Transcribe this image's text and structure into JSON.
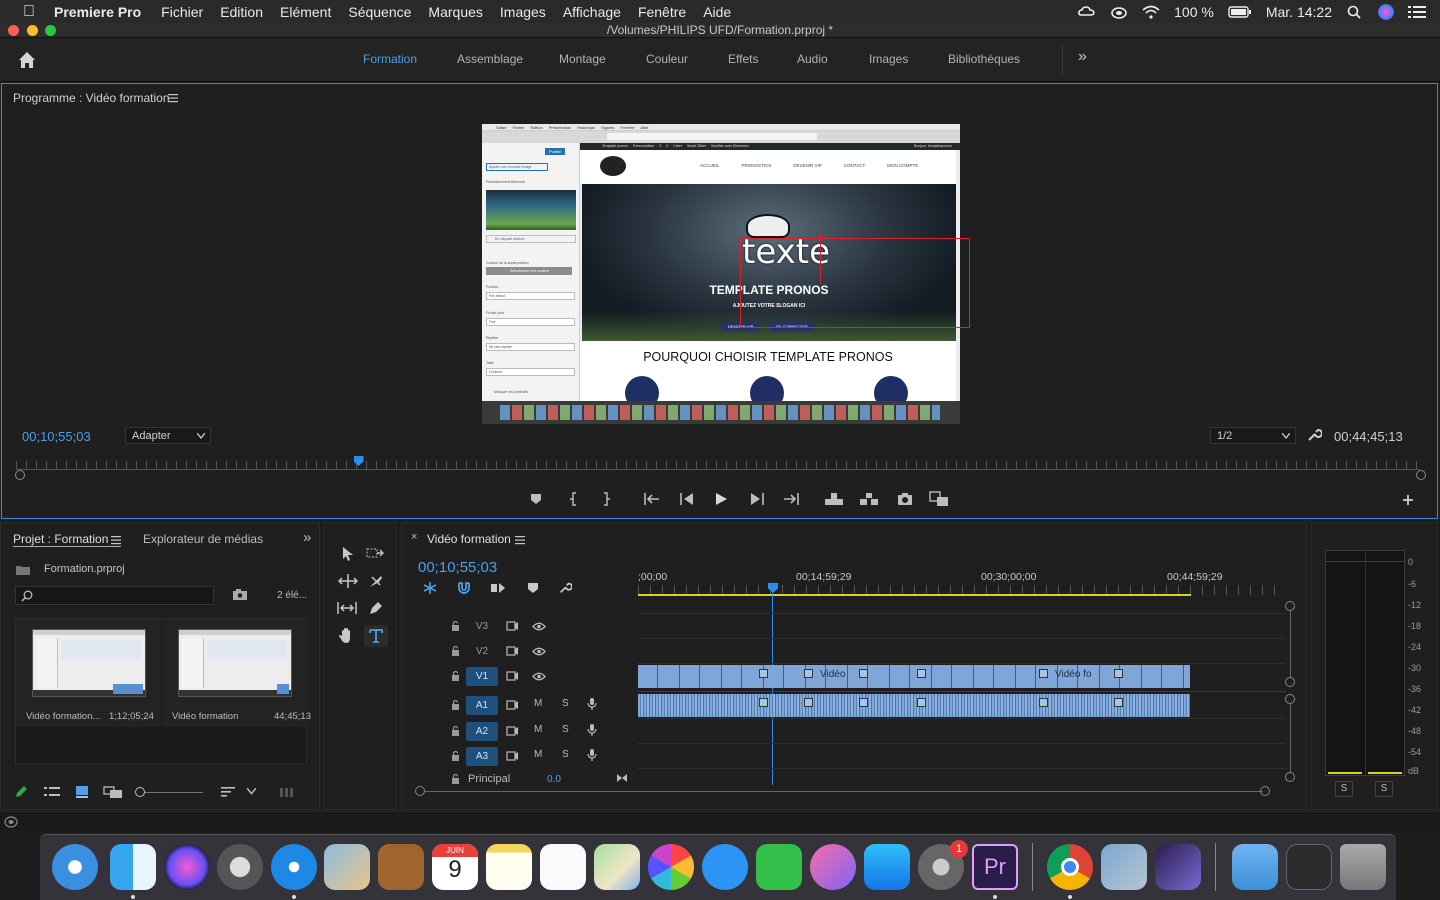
{
  "menubar": {
    "app_name": "Premiere Pro",
    "menus": [
      "Fichier",
      "Edition",
      "Elément",
      "Séquence",
      "Marques",
      "Images",
      "Affichage",
      "Fenêtre",
      "Aide"
    ],
    "battery": "100 %",
    "clock": "Mar. 14:22"
  },
  "window": {
    "title": "/Volumes/PHILIPS UFD/Formation.prproj *"
  },
  "workspaces": {
    "tabs": [
      "Formation",
      "Assemblage",
      "Montage",
      "Couleur",
      "Effets",
      "Audio",
      "Images",
      "Bibliothèques"
    ],
    "active": "Formation",
    "more": "»"
  },
  "program": {
    "title": "Programme : Vidéo formation",
    "timecode": "00;10;55;03",
    "fit": "Adapter",
    "resolution": "1/2",
    "duration": "00;44;45;13",
    "playhead_fraction": 0.244
  },
  "video": {
    "menu": [
      "Safari",
      "Fichier",
      "Édition",
      "Présentation",
      "Historique",
      "Signets",
      "Fenêtre",
      "Aide"
    ],
    "sidebar": {
      "publish": "Publier",
      "add_image": "Ajouter une nouvelle image",
      "prev_label": "Précédemment téléversé",
      "choose": "En cliquant ailleurs",
      "overlay_label": "Couleur de la superposition",
      "overlay_btn": "Sélectionner une couleur",
      "position_label": "Position",
      "position_val": "Par défaut",
      "attach_label": "Fichier joint",
      "attach_val": "Fixé",
      "repeat_label": "Répéter",
      "repeat_val": "Ne pas répéter",
      "size_label": "Taille",
      "size_val": "Contenir",
      "hide": "Masquer les contrôles"
    },
    "nav": [
      "ACCUEIL",
      "PRONOSTICS",
      "DEVENIR VIP",
      "CONTACT",
      "MON COMPTE"
    ],
    "admin_bar": [
      "Template pronos",
      "Personnaliser",
      "2",
      "0",
      "Créer",
      "Smart Slider",
      "Modifier avec Elementor"
    ],
    "admin_right": "Bonjour, templatepronos",
    "hero_overlay_text": "texte",
    "hero_title": "TEMPLATE PRONOS",
    "hero_slogan": "AJOUTEZ VOTRE SLOGAN ICI",
    "btn_vip": "DEVENIR VIP",
    "btn_login": "SE CONNECTER",
    "section_title": "POURQUOI CHOISIR TEMPLATE PRONOS"
  },
  "project": {
    "tab_project": "Projet : Formation",
    "tab_media": "Explorateur de médias",
    "file": "Formation.prproj",
    "count": "2 élé...",
    "items": [
      {
        "name": "Vidéo formation...",
        "duration": "1;12;05;24"
      },
      {
        "name": "Vidéo formation",
        "duration": "44;45;13"
      }
    ]
  },
  "timeline": {
    "title": "Vidéo formation",
    "timecode": "00;10;55;03",
    "ruler": [
      ";00;00",
      "00;14;59;29",
      "00;30;00;00",
      "00;44;59;29"
    ],
    "video_tracks": [
      "V3",
      "V2",
      "V1"
    ],
    "audio_tracks": [
      "A1",
      "A2",
      "A3"
    ],
    "master": "Principal",
    "master_value": "0.0",
    "clip_labels": [
      "Vidéo",
      "Vidéo fo"
    ]
  },
  "meter": {
    "labels": [
      "0",
      "-6",
      "-12",
      "-18",
      "-24",
      "-30",
      "-36",
      "-42",
      "-48",
      "-54",
      "dB"
    ],
    "solo": [
      "S",
      "S"
    ]
  },
  "dock": {
    "calendar_month": "JUIN",
    "calendar_day": "9",
    "badge": "1",
    "premiere_label": "Pr"
  },
  "colors": {
    "accent_blue": "#2d8ceb",
    "clip_blue": "#7fa6d6",
    "work_area": "#d4d423"
  }
}
